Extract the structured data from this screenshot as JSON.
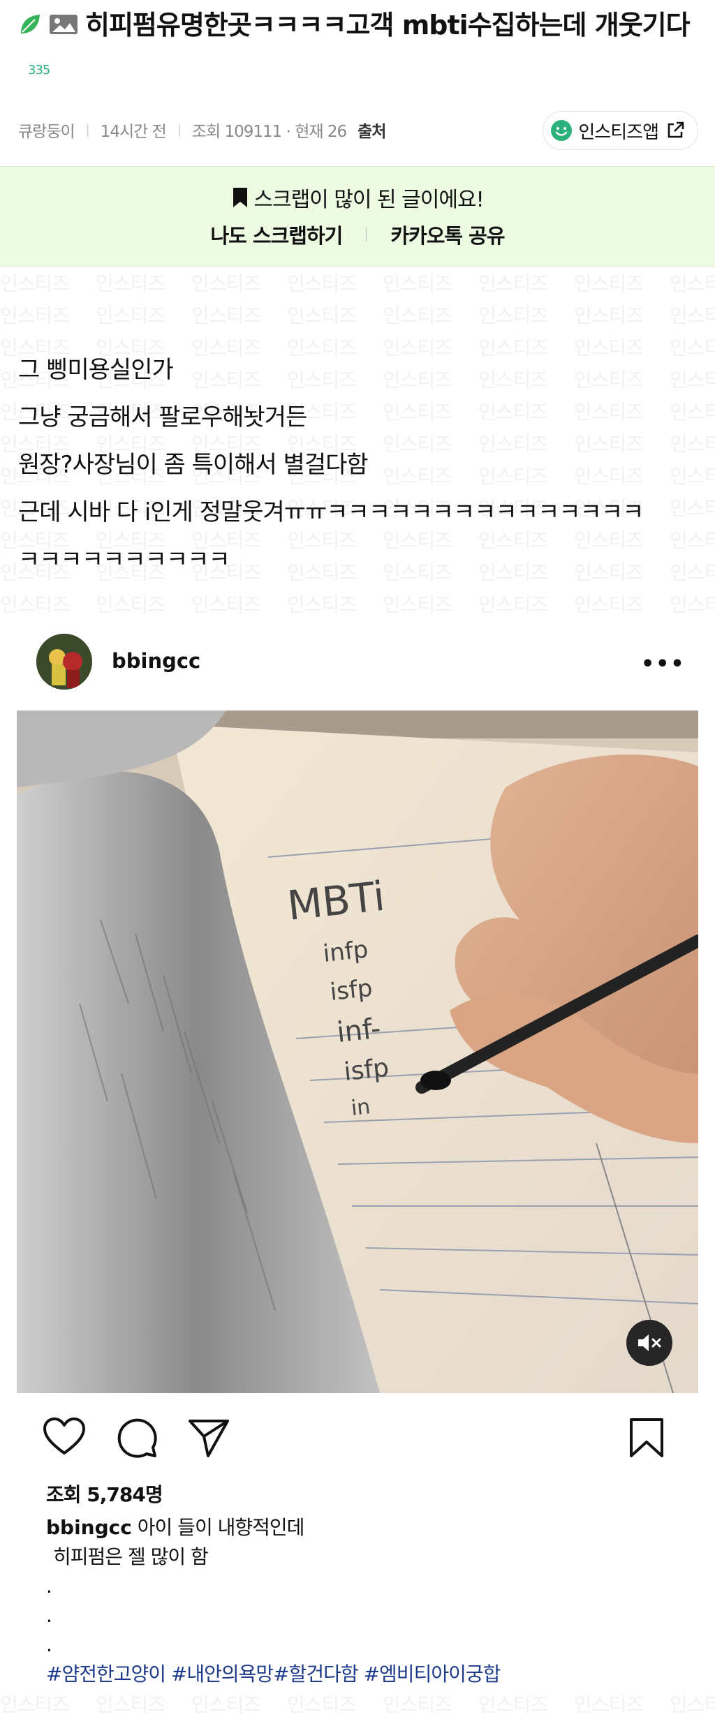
{
  "post": {
    "title": "히피펌유명한곳ㅋㅋㅋㅋ고객 mbti수집하는데 개웃기다",
    "comment_count": "335",
    "author": "큐랑둥이",
    "time": "14시간 전",
    "views": "조회 109111 · 현재 26",
    "source": "출처",
    "app_button": "인스티즈앱"
  },
  "banner": {
    "message": "스크랩이 많이 된 글이에요!",
    "scrap": "나도 스크랩하기",
    "share": "카카오톡 공유"
  },
  "watermark": "인스티즈",
  "body": {
    "lines": [
      "그 삥미용실인가",
      "그냥 궁금해서 팔로우해놧거든",
      "원장?사장님이 좀 특이해서 별걸다함",
      "근데 시바 다 i인게 정말웃겨ㅠㅠㅋㅋㅋㅋㅋㅋㅋㅋㅋㅋㅋㅋㅋㅋㅋ",
      "ㅋㅋㅋㅋㅋㅋㅋㅋㅋㅋ"
    ]
  },
  "instagram": {
    "username": "bbingcc",
    "more": "•••",
    "views": "조회 5,784명",
    "caption_user": "bbingcc",
    "caption_line1": "아이 들이  내향적인데",
    "caption_line2": "히피펌은 젤 많이 함",
    "caption_dots": [
      ".",
      ".",
      "."
    ],
    "hashtags": "#얌전한고양이 #내안의욕망#할건다함 #엠비티아이궁합",
    "media_text": {
      "heading": "MBTi",
      "entries": [
        "infp",
        "isfp",
        "inf-",
        "isfp",
        "in"
      ]
    }
  },
  "colors": {
    "banner_bg": "#eefbe3",
    "accent_green": "#2bb27a",
    "hashtag": "#1e3a8a"
  }
}
